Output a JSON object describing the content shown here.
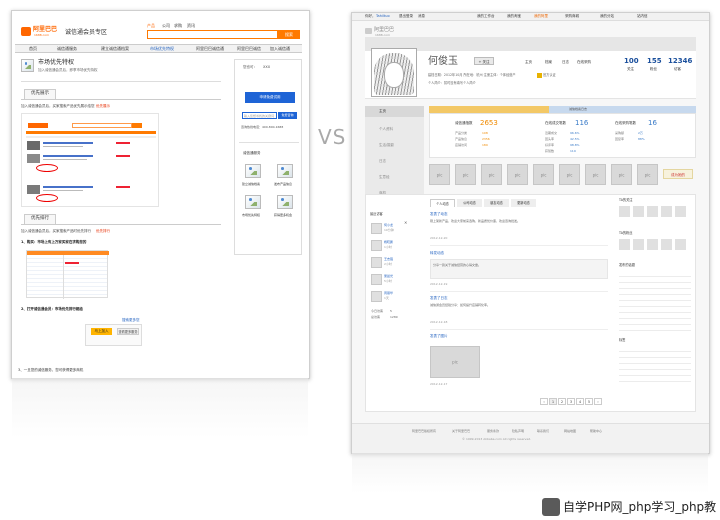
{
  "left_page": {
    "logo_text": "阿里巴巴",
    "logo_sub": "1688.com",
    "section_title": "诚信通会员专区",
    "search_tabs": [
      "产品",
      "公司",
      "求购",
      "资讯"
    ],
    "search_button": "搜索",
    "nav": [
      "首页",
      "诚信通服务",
      "建立诚信通档案",
      "市场优先特权",
      "阿里巴巴诚信通",
      "阿里巴巴诚信",
      "加入诚信通"
    ],
    "headline": "市场优先特权",
    "headline_sub": "加入诚信通会员后，即享市场优先特权",
    "section1_title": "优先展示",
    "section1_text": "加入诚信通会员后，买家搜索产品优先展示给您",
    "section1_link": "优先展示",
    "section2_title": "优先排行",
    "section2_text": "加入诚信通会员后，买家搜索产品时优先排行",
    "section2_link": "优先排行",
    "step1": "1、购买：市场上有上万家买家在求购您的",
    "step2": "2、打开诚信通会员：市场优先排行都给",
    "step2_link": "搜索更多您",
    "join_button": "马上加入",
    "more_button": "查看更多服务",
    "footer_note": "3、一旦您的诚信服务，您可获得更多商机",
    "sidebar_label": "您也可：",
    "sidebar_label_value": "XXX",
    "sidebar_cta": "申请免费试用",
    "sidebar_input_placeholder": "输入您想寻找的关键词",
    "sidebar_btn": "免费咨询",
    "sidebar_hotline": "咨询热线电话：400-800-1688",
    "sidebar_grid_title": "诚信通服务",
    "sidebar_items": [
      "建立诚信档案",
      "发布产品信息",
      "市场优先特权",
      "获得更多机会"
    ]
  },
  "vs_label": "VS",
  "right_page": {
    "topbar_left": [
      "你好，",
      "Tahiltuo",
      "退出登录",
      "消息"
    ],
    "topbar_right": [
      "我的工作台",
      "我的淘宝",
      "我的阿里",
      "采购商城",
      "我的分站",
      "站内信"
    ],
    "logo_text": "阿里巴巴",
    "logo_sub": "1688.com",
    "banner_placeholder": "pic（用户个性化展示）",
    "user_name": "何俊玉",
    "follow_button": "+ 关注",
    "header_links": [
      "主页",
      "档案",
      "日志",
      "在线采购"
    ],
    "stat_values": [
      "100",
      "155",
      "12346"
    ],
    "stat_labels": [
      "关注",
      "粉丝",
      "访客"
    ],
    "tagline": "建档日期：2012年10月  所在地：杭州  注册主体：个体经营户",
    "intro_line": "个人简介：暂时没有填写个人简介",
    "badge_text": "官方认证",
    "side_menu": [
      "主页",
      "个人资料",
      "生活/摄影",
      "日志",
      "生意经",
      "商机"
    ],
    "bar_label": "诚信档案日志",
    "credit_block": {
      "title": "诚信通指数",
      "score": "2653",
      "rows": [
        [
          "产品分类",
          "108"
        ],
        [
          "产品信息",
          "2356"
        ],
        [
          "店铺访问",
          "189"
        ]
      ]
    },
    "deal_block": {
      "title": "在线成交笔数",
      "value": "116",
      "rows": [
        [
          "近期成交",
          "96.6%"
        ],
        [
          "回头率",
          "42.5%"
        ],
        [
          "好评率",
          "98.8%"
        ],
        [
          "获赞数",
          "119"
        ]
      ]
    },
    "buyer_block": {
      "title": "在线采购笔数",
      "value": "16",
      "rows": [
        [
          "采购额",
          "2万"
        ],
        [
          "回复率",
          "88%"
        ]
      ]
    },
    "photo_pic_label": "pic",
    "photo_extra": "成为她的",
    "tabs": [
      "个人动态",
      "公司动态",
      "朋友动态",
      "更新动态"
    ],
    "recent_visitors_title": "最近访客",
    "visitors": [
      [
        "何小龙",
        "10分钟"
      ],
      [
        "杨晓鹏",
        "1小时"
      ],
      [
        "王志强",
        "2小时"
      ],
      [
        "吴晨光",
        "5小时"
      ],
      [
        "周丽华",
        "1天"
      ]
    ],
    "visitor_stats": [
      [
        "今日访客",
        "5"
      ],
      [
        "总访客",
        "1289"
      ]
    ],
    "feed": [
      {
        "title": "发表了动态",
        "body": "刚上架新产品，欢迎大家前来选购，新品质优价廉，欢迎咨询批发。",
        "meta": "2012-12-20"
      },
      {
        "title": "转发动态",
        "body": "分享一篇关于诚信经营的心得文章。",
        "meta": "2012-12-19"
      },
      {
        "title": "发表了日志",
        "body": "诚信通会员经验分享：如何提升店铺转化率。",
        "meta": "2012-12-18"
      },
      {
        "title": "发表了图片",
        "body": "新品实拍图",
        "meta": "2012-12-17"
      }
    ],
    "feed_pic": "pic",
    "pagination": [
      "‹",
      "1",
      "2",
      "3",
      "4",
      "5",
      "›"
    ],
    "right_col_titles": [
      "TA的关注",
      "TA的粉丝",
      "发布的话题",
      "标签"
    ],
    "footer_links": [
      "阿里巴巴版权所有",
      "关于阿里巴巴",
      "服务条款",
      "隐私声明",
      "联系我们",
      "网站地图",
      "帮助中心"
    ],
    "footer_line2": "© 1999-2013 Alibaba.com All rights reserved."
  },
  "watermark": "自学PHP网_php学习_php教"
}
